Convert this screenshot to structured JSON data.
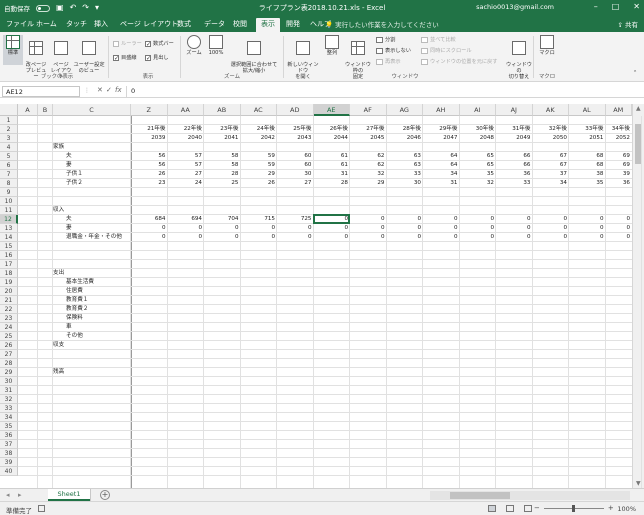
{
  "titlebar": {
    "autosave": "自動保存",
    "title": "ライフプラン表2018.10.21.xls  -  Excel",
    "user": "sachio0013@gmail.com"
  },
  "ribbon_tabs": [
    {
      "label": "ファイル",
      "active": false
    },
    {
      "label": "ホーム",
      "active": false
    },
    {
      "label": "タッチ",
      "active": false
    },
    {
      "label": "挿入",
      "active": false
    },
    {
      "label": "ページ レイアウト",
      "active": false
    },
    {
      "label": "数式",
      "active": false
    },
    {
      "label": "データ",
      "active": false
    },
    {
      "label": "校閲",
      "active": false
    },
    {
      "label": "表示",
      "active": true
    },
    {
      "label": "開発",
      "active": false
    },
    {
      "label": "ヘルプ",
      "active": false
    }
  ],
  "tell_me": "実行したい作業を入力してください",
  "share": "共有",
  "ribbon": {
    "view_buttons": {
      "normal": "標準",
      "page_break": "改ページ\nプレビュー",
      "page_layout": "ページ\nレイアウト",
      "custom": "ユーザー設定\nのビュー"
    },
    "show": {
      "ruler": "ルーラー",
      "formula_bar": "数式バー",
      "gridlines": "目盛線",
      "headings": "見出し"
    },
    "zoom": {
      "zoom": "ズーム",
      "hundred": "100%",
      "selection": "選択範囲に合わせて\n拡大/縮小"
    },
    "window": {
      "new_window": "新しいウィンドウ\nを開く",
      "arrange": "整列",
      "freeze": "ウィンドウ枠の\n固定",
      "split": "分割",
      "hide": "表示しない",
      "unhide": "再表示",
      "side_by_side": "並べて比較",
      "sync_scroll": "同時にスクロール",
      "reset_position": "ウィンドウの位置を元に戻す",
      "switch": "ウィンドウの\n切り替え"
    },
    "macro": {
      "macro": "マクロ"
    },
    "groups": {
      "workbook_views": "ブックの表示",
      "show": "表示",
      "zoom": "ズーム",
      "window": "ウィンドウ",
      "macros": "マクロ"
    }
  },
  "formula_bar": {
    "name_box": "AE12",
    "value": "0"
  },
  "columns": {
    "left": [
      "A",
      "B",
      "C"
    ],
    "right": [
      "Z",
      "AA",
      "AB",
      "AC",
      "AD",
      "AE",
      "AF",
      "AG",
      "AH",
      "AI",
      "AJ",
      "AK",
      "AL",
      "AM"
    ],
    "selected": "AE"
  },
  "rows_visible": 40,
  "selected_row": 12,
  "sheet": {
    "row2_years_after": [
      "21年後",
      "22年後",
      "23年後",
      "24年後",
      "25年後",
      "26年後",
      "27年後",
      "28年後",
      "29年後",
      "30年後",
      "31年後",
      "32年後",
      "33年後",
      "34年後"
    ],
    "row3_years": [
      "2039",
      "2040",
      "2041",
      "2042",
      "2043",
      "2044",
      "2045",
      "2046",
      "2047",
      "2048",
      "2049",
      "2050",
      "2051",
      "2052"
    ],
    "section_family": "家族",
    "family_rows": [
      {
        "label": "夫",
        "values": [
          "56",
          "57",
          "58",
          "59",
          "60",
          "61",
          "62",
          "63",
          "64",
          "65",
          "66",
          "67",
          "68",
          "69"
        ]
      },
      {
        "label": "妻",
        "values": [
          "56",
          "57",
          "58",
          "59",
          "60",
          "61",
          "62",
          "63",
          "64",
          "65",
          "66",
          "67",
          "68",
          "69"
        ]
      },
      {
        "label": "子供１",
        "values": [
          "26",
          "27",
          "28",
          "29",
          "30",
          "31",
          "32",
          "33",
          "34",
          "35",
          "36",
          "37",
          "38",
          "39"
        ]
      },
      {
        "label": "子供２",
        "values": [
          "23",
          "24",
          "25",
          "26",
          "27",
          "28",
          "29",
          "30",
          "31",
          "32",
          "33",
          "34",
          "35",
          "36"
        ]
      }
    ],
    "section_income": "収入",
    "income_rows": [
      {
        "label": "夫",
        "values": [
          "684",
          "694",
          "704",
          "715",
          "725",
          "0",
          "0",
          "0",
          "0",
          "0",
          "0",
          "0",
          "0",
          "0"
        ]
      },
      {
        "label": "妻",
        "values": [
          "0",
          "0",
          "0",
          "0",
          "0",
          "0",
          "0",
          "0",
          "0",
          "0",
          "0",
          "0",
          "0",
          "0"
        ]
      },
      {
        "label": "退職金・年金・その他",
        "values": [
          "0",
          "0",
          "0",
          "0",
          "0",
          "0",
          "0",
          "0",
          "0",
          "0",
          "0",
          "0",
          "0",
          "0"
        ]
      }
    ],
    "section_expense": "支出",
    "expense_labels": [
      "基本生活費",
      "住居費",
      "教育費１",
      "教育費２",
      "保険料",
      "車",
      "その他"
    ],
    "section_balance": "収支",
    "section_savings": "残高"
  },
  "sheet_tabs": [
    "Sheet1"
  ],
  "status": {
    "ready": "準備完了",
    "zoom": "100%"
  }
}
